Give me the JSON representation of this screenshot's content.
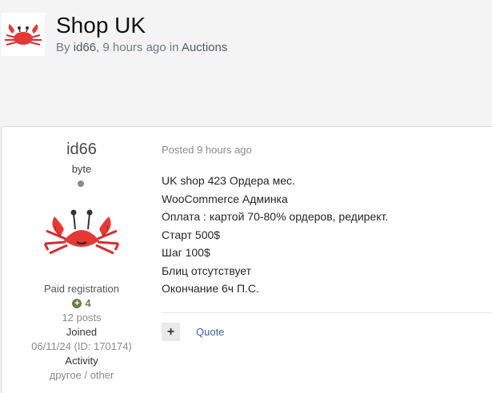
{
  "topic": {
    "title": "Shop UK",
    "byline": {
      "by_label": "By",
      "author": "id66",
      "separator": ",",
      "time": "9 hours ago",
      "in_label": "in",
      "forum": "Auctions"
    }
  },
  "post": {
    "author": {
      "name": "id66",
      "group": "byte",
      "status": "offline",
      "avatar_icon": "crab-avatar-icon",
      "paid_registration": "Paid registration",
      "reputation_icon": "plus-circle-icon",
      "reputation": "4",
      "post_count": "12 posts",
      "joined_label": "Joined",
      "joined_value": "06/11/24 (ID: 170174)",
      "activity_label": "Activity",
      "activity_value": "другое / other"
    },
    "posted_label": "Posted 9 hours ago",
    "body_lines": [
      "UK shop 423 Ордера мес.",
      "WooCommerce Админка",
      "Оплата : картой 70-80% ордеров, редирект.",
      "Старт 500$",
      "Шаг 100$",
      "Блиц отсутствует",
      "Окончание 6ч П.С."
    ],
    "actions": {
      "multiquote_symbol": "+",
      "quote_label": "Quote"
    }
  },
  "colors": {
    "page_background": "#f4f4f4",
    "link": "#3d6594",
    "reputation_positive": "#6c7f4a",
    "crab_red": "#e53935"
  }
}
